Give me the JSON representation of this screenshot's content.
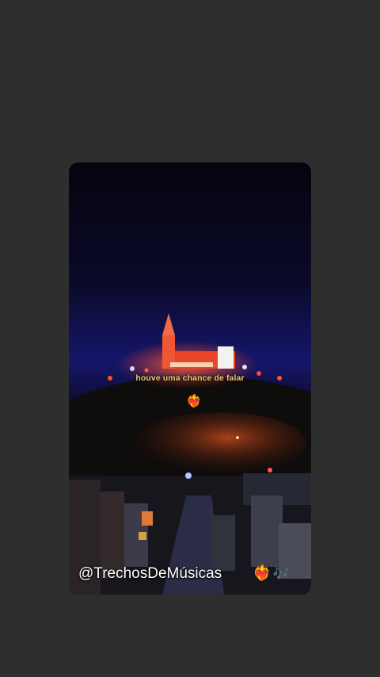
{
  "video": {
    "caption": "houve uma chance de falar",
    "heart_emoji": "❤️‍🔥",
    "watermark": "@TrechosDeMúsicas",
    "watermark_emoji": "❤️‍🔥",
    "music_icon": "🎶",
    "background_color": "#2e2e2e",
    "caption_color": "#e9d27a"
  }
}
